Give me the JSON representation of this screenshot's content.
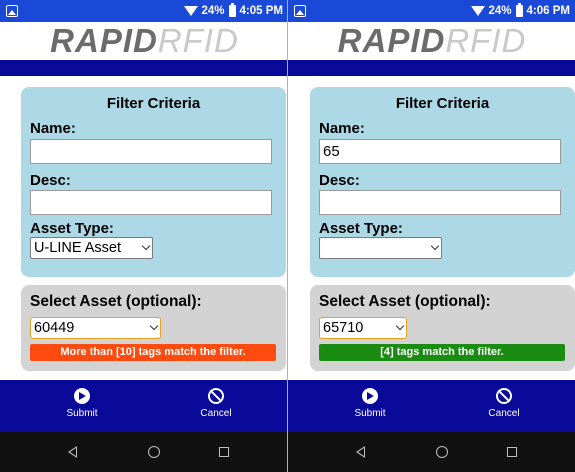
{
  "colors": {
    "status_bar": "#1a49d8",
    "nav_band": "#0a0a9a",
    "filter_panel": "#add8e6",
    "select_panel": "#d3d3d3",
    "warning": "#ff4b0f",
    "success": "#1b8c12",
    "android_nav": "#111111"
  },
  "left": {
    "status": {
      "battery": "24%",
      "time": "4:05 PM"
    },
    "logo": {
      "bold": "RAPID",
      "light": "RFID"
    },
    "filter": {
      "title": "Filter Criteria",
      "name_label": "Name:",
      "name_value": "",
      "desc_label": "Desc:",
      "desc_value": "",
      "asset_type_label": "Asset Type:",
      "asset_type_value": "U-LINE Asset"
    },
    "select": {
      "title": "Select Asset (optional):",
      "value": "60449",
      "message": "More than [10] tags match the filter."
    },
    "buttons": {
      "submit": "Submit",
      "cancel": "Cancel"
    }
  },
  "right": {
    "status": {
      "battery": "24%",
      "time": "4:06 PM"
    },
    "logo": {
      "bold": "RAPID",
      "light": "RFID"
    },
    "filter": {
      "title": "Filter Criteria",
      "name_label": "Name:",
      "name_value": "65",
      "desc_label": "Desc:",
      "desc_value": "",
      "asset_type_label": "Asset Type:",
      "asset_type_value": ""
    },
    "select": {
      "title": "Select Asset (optional):",
      "value": "65710",
      "message": "[4] tags match the filter."
    },
    "buttons": {
      "submit": "Submit",
      "cancel": "Cancel"
    }
  },
  "icons": {
    "notification": "image-notification-icon",
    "wifi": "wifi-icon",
    "battery": "battery-icon",
    "submit": "play-circle-icon",
    "cancel": "cancel-circle-icon",
    "back": "back-triangle-icon",
    "home": "home-circle-icon",
    "recents": "recents-square-icon"
  }
}
